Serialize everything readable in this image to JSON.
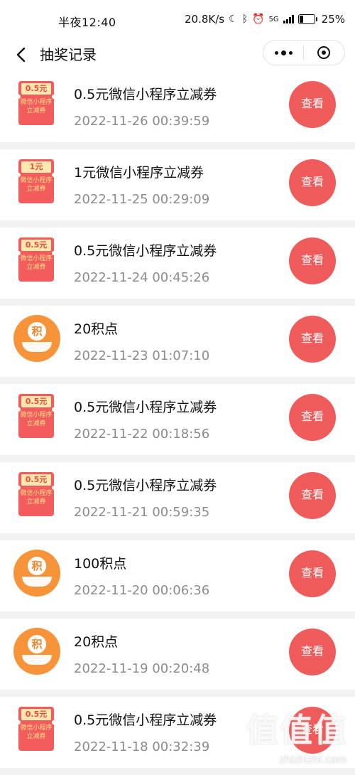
{
  "status_bar": {
    "time": "半夜12:40",
    "net_speed": "20.8K/s",
    "network": "5G",
    "battery": "25%"
  },
  "nav": {
    "title": "抽奖记录"
  },
  "records": [
    {
      "type": "coupon",
      "badge": "0.5元",
      "badge_desc": "微信小程序立减券",
      "title": "0.5元微信小程序立减券",
      "time": "2022-11-26 00:39:59",
      "action": "查看"
    },
    {
      "type": "coupon",
      "badge": "1元",
      "badge_desc": "微信小程序立减券",
      "title": "1元微信小程序立减券",
      "time": "2022-11-25 00:29:09",
      "action": "查看"
    },
    {
      "type": "coupon",
      "badge": "0.5元",
      "badge_desc": "微信小程序立减券",
      "title": "0.5元微信小程序立减券",
      "time": "2022-11-24 00:45:26",
      "action": "查看"
    },
    {
      "type": "points",
      "badge": "积",
      "title": "20积点",
      "time": "2022-11-23 01:07:10",
      "action": "查看"
    },
    {
      "type": "coupon",
      "badge": "0.5元",
      "badge_desc": "微信小程序立减券",
      "title": "0.5元微信小程序立减券",
      "time": "2022-11-22 00:18:56",
      "action": "查看"
    },
    {
      "type": "coupon",
      "badge": "0.5元",
      "badge_desc": "微信小程序立减券",
      "title": "0.5元微信小程序立减券",
      "time": "2022-11-21 00:59:35",
      "action": "查看"
    },
    {
      "type": "points",
      "badge": "积",
      "title": "100积点",
      "time": "2022-11-20 00:06:36",
      "action": "查看"
    },
    {
      "type": "points",
      "badge": "积",
      "title": "20积点",
      "time": "2022-11-19 00:20:48",
      "action": "查看"
    },
    {
      "type": "coupon",
      "badge": "0.5元",
      "badge_desc": "微信小程序立减券",
      "title": "0.5元微信小程序立减券",
      "time": "2022-11-18 00:32:39",
      "action": "查看"
    }
  ],
  "watermark": {
    "text": "值值值",
    "url": "zhizhizhi.com"
  },
  "colors": {
    "accent_red": "#ef5a5a",
    "coupon_red": "#f25c5c",
    "points_orange": "#f7943a",
    "time_gray": "#8c8c8c"
  }
}
